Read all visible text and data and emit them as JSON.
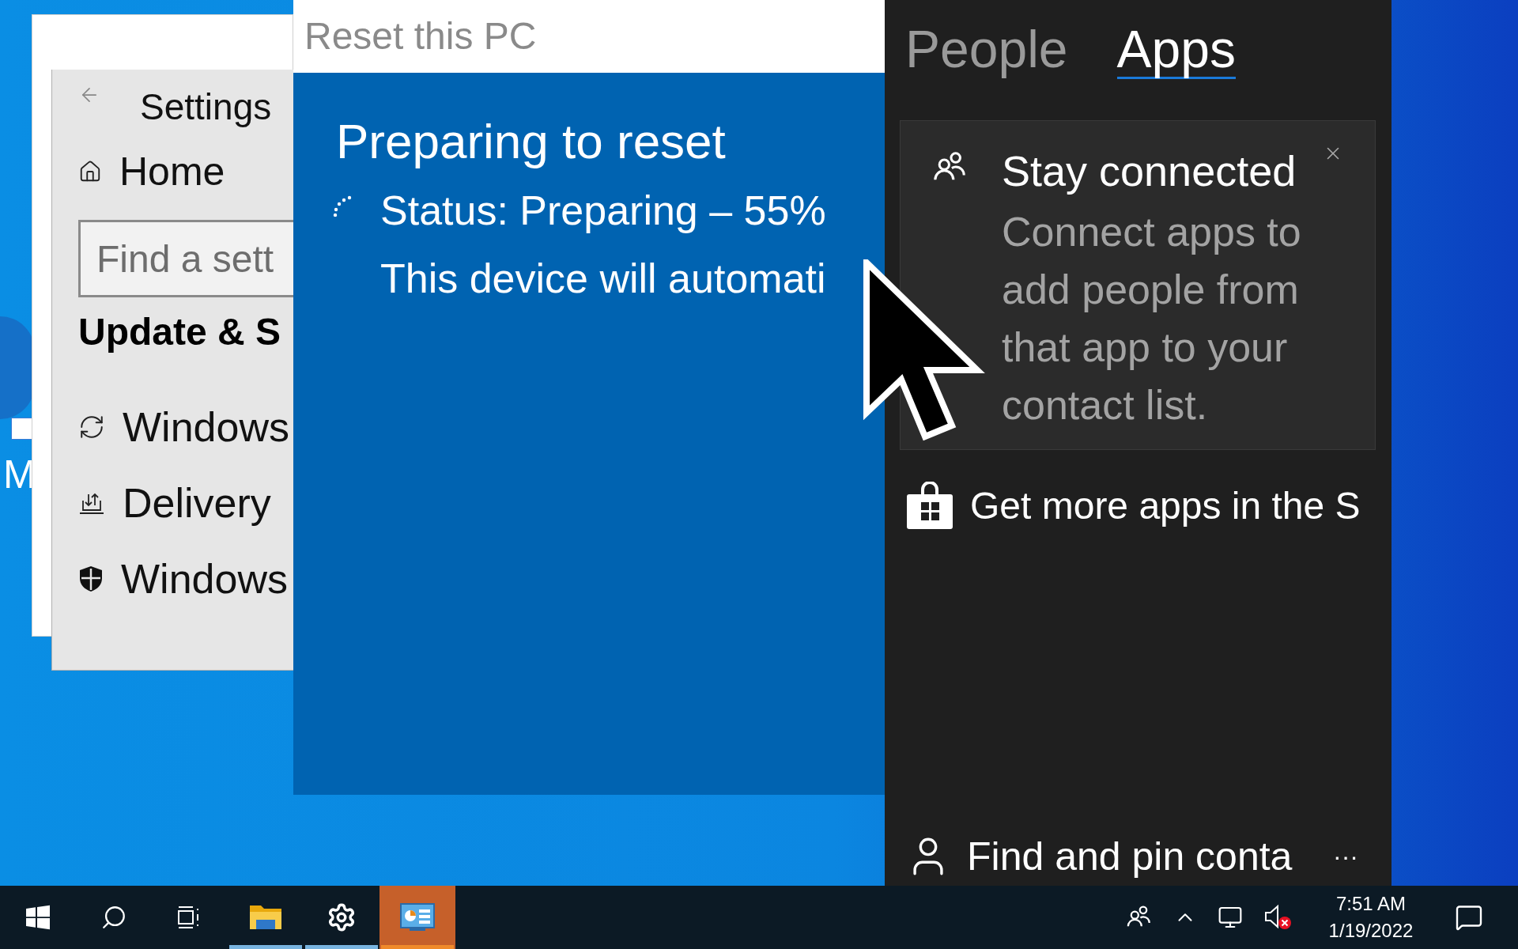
{
  "desktop": {
    "icon_label": "M"
  },
  "settings_window": {
    "title": "Settings",
    "home": "Home",
    "search": {
      "placeholder": "Find a sett"
    },
    "section": "Update & S",
    "items": [
      {
        "kind": "update",
        "label": "Windows"
      },
      {
        "kind": "delivery",
        "label": "Delivery"
      },
      {
        "kind": "security",
        "label": "Windows"
      }
    ]
  },
  "reset_window": {
    "title": "Reset this PC",
    "heading": "Preparing to reset",
    "status": "Status: Preparing – 55%",
    "note": "This device will automati"
  },
  "people_panel": {
    "tabs": [
      {
        "label": "People",
        "selected": false
      },
      {
        "label": "Apps",
        "selected": true
      }
    ],
    "card": {
      "title": "Stay connected",
      "text": "Connect apps to add people from that app to your contact list."
    },
    "store_link": "Get more apps in the S",
    "find_contacts": "Find and pin conta",
    "more": "···"
  },
  "taskbar": {
    "apps": [
      {
        "kind": "start",
        "running": false,
        "selected": false
      },
      {
        "kind": "search",
        "running": false,
        "selected": false
      },
      {
        "kind": "task-view",
        "running": false,
        "selected": false
      },
      {
        "kind": "folder",
        "running": true,
        "selected": false
      },
      {
        "kind": "settings",
        "running": true,
        "selected": false
      },
      {
        "kind": "control-panel",
        "running": true,
        "selected": true
      }
    ],
    "time": "7:51 AM",
    "date": "1/19/2022"
  }
}
